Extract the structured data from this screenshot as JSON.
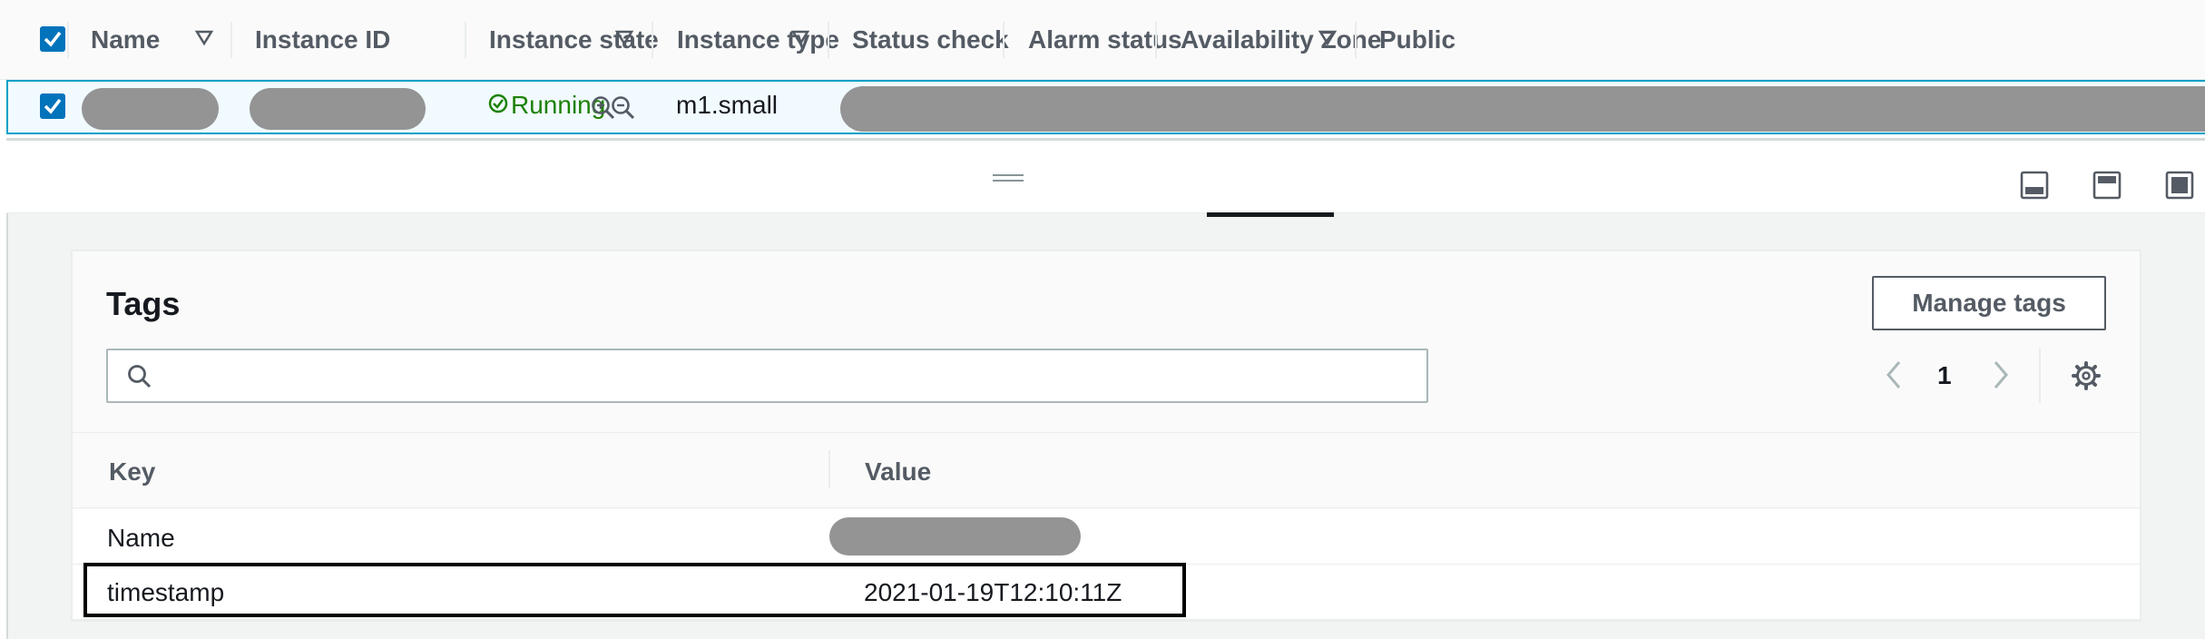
{
  "table": {
    "columns": [
      {
        "label": "Name"
      },
      {
        "label": "Instance ID"
      },
      {
        "label": "Instance state"
      },
      {
        "label": "Instance type"
      },
      {
        "label": "Status check"
      },
      {
        "label": "Alarm status"
      },
      {
        "label": "Availability Zone"
      },
      {
        "label": "Public"
      }
    ],
    "row": {
      "selected": true,
      "instance_state": "Running",
      "instance_type": "m1.small"
    }
  },
  "tags_panel": {
    "title": "Tags",
    "manage_button": "Manage tags",
    "search_value": "",
    "search_placeholder": "",
    "page_number": "1",
    "headers": {
      "key": "Key",
      "value": "Value"
    },
    "rows": [
      {
        "key": "Name",
        "value": ""
      },
      {
        "key": "timestamp",
        "value": "2021-01-19T12:10:11Z"
      }
    ]
  },
  "colors": {
    "accent": "#0073bb",
    "running": "#1d8102",
    "selected_row_bg": "#f1faff",
    "selected_row_border": "#00a1c9"
  },
  "icons": [
    "checkbox-checked-icon",
    "sort-triangle-icon",
    "status-running-icon",
    "zoom-in-icon",
    "zoom-out-icon",
    "drag-handle-icon",
    "dock-bottom-icon",
    "dock-side-icon",
    "fullscreen-icon",
    "search-icon",
    "chevron-left-icon",
    "chevron-right-icon",
    "gear-icon"
  ]
}
